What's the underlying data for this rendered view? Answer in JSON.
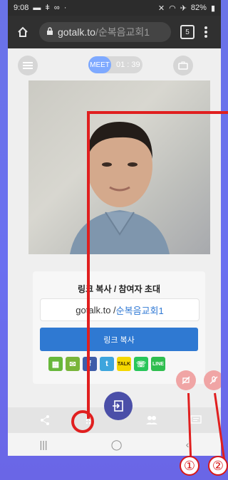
{
  "status_bar": {
    "time": "9:08",
    "left_icons": [
      "message-icon",
      "signal-icon",
      "link-icon"
    ],
    "battery": "82%"
  },
  "browser": {
    "domain": "gotalk.to",
    "path": "/순복음교회1",
    "tab_count": "5"
  },
  "top_controls": {
    "meet_label": "MEET",
    "timer": "01 : 39"
  },
  "card": {
    "title": "링크 복사 / 참여자 초대",
    "link_prefix": "gotalk.to / ",
    "link_slug": "순복음교회1",
    "copy_button": "링크 복사"
  },
  "share_buttons": [
    {
      "name": "sms-icon",
      "color": "#67b83b",
      "glyph": "⠿"
    },
    {
      "name": "email-icon",
      "color": "#79b53a",
      "glyph": "✉"
    },
    {
      "name": "facebook-icon",
      "color": "#3f5da9",
      "glyph": "f"
    },
    {
      "name": "twitter-icon",
      "color": "#3da5dd",
      "glyph": "t"
    },
    {
      "name": "kakaotalk-icon",
      "color": "#f4d700",
      "glyph": "TALK"
    },
    {
      "name": "whatsapp-icon",
      "color": "#28c65a",
      "glyph": "☏"
    },
    {
      "name": "line-icon",
      "color": "#2fbe4f",
      "glyph": "LINE"
    }
  ],
  "annotations": {
    "marker_1": "①",
    "marker_2": "②"
  },
  "colors": {
    "accent_red": "#e01f1f",
    "brand_blue": "#2f79d2",
    "fab_blue": "#4b4fa8",
    "mute_pink": "#f0a5a5"
  }
}
